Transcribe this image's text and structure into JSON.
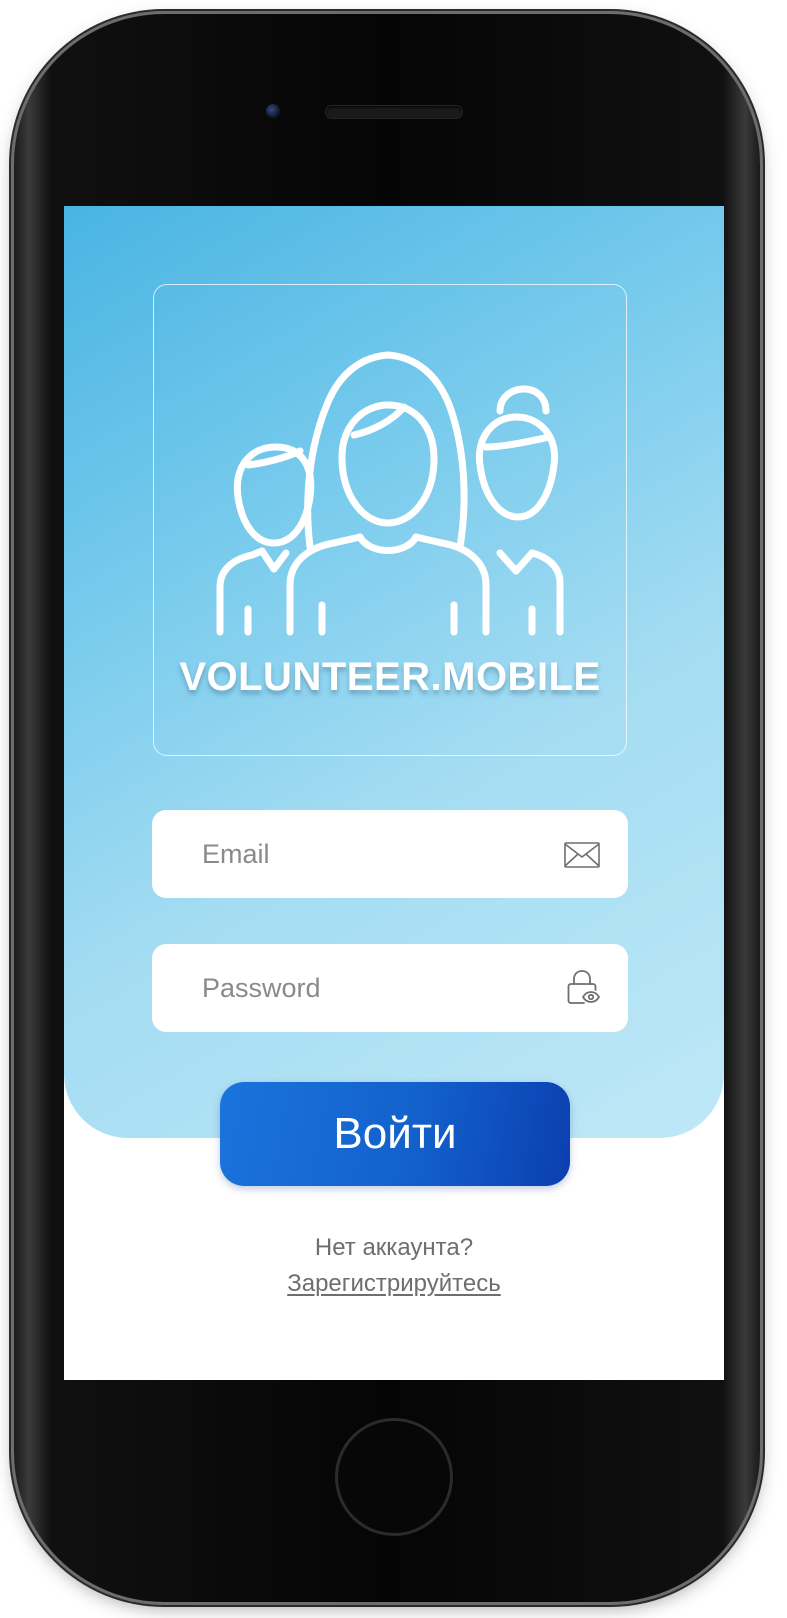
{
  "app": {
    "brand": "VOLUNTEER.MOBILE",
    "logo_icon": "volunteers-group-icon"
  },
  "form": {
    "email_placeholder": "Email",
    "email_icon": "envelope-icon",
    "password_placeholder": "Password",
    "password_icon": "lock-eye-icon",
    "submit_label": "Войти"
  },
  "footer": {
    "question": "Нет аккаунта?",
    "register_link": "Зарегистрируйтесь"
  },
  "colors": {
    "hero_gradient_start": "#49b4e2",
    "hero_gradient_end": "#bfe8f7",
    "button_start": "#1b73dc",
    "button_end": "#0b3fb0",
    "muted_text": "#6e6e6e"
  }
}
